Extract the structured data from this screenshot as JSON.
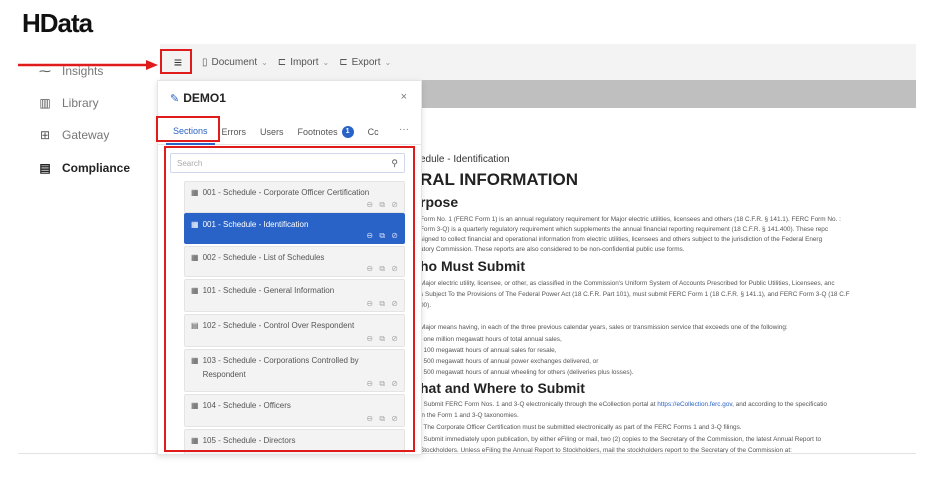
{
  "logo": "HData",
  "nav": [
    {
      "label": "Insights",
      "icon": "insights-icon",
      "glyph": "⁓",
      "active": false
    },
    {
      "label": "Library",
      "icon": "library-icon",
      "glyph": "▥",
      "active": false
    },
    {
      "label": "Gateway",
      "icon": "gateway-icon",
      "glyph": "⊞",
      "active": false
    },
    {
      "label": "Compliance",
      "icon": "compliance-icon",
      "glyph": "▤",
      "active": true
    }
  ],
  "toolbar": {
    "menu_glyph": "≡",
    "items": [
      {
        "label": "Document",
        "glyph": "▯"
      },
      {
        "label": "Import",
        "glyph": "⊏"
      },
      {
        "label": "Export",
        "glyph": "⊏"
      }
    ],
    "caret": "⌄"
  },
  "panel": {
    "title": "DEMO1",
    "close": "×",
    "tabs": [
      {
        "label": "Sections",
        "active": true
      },
      {
        "label": "Errors",
        "active": false
      },
      {
        "label": "Users",
        "active": false
      },
      {
        "label": "Footnotes",
        "active": false,
        "badge": "1"
      },
      {
        "label": "Cc",
        "active": false
      }
    ],
    "more": "···",
    "search_placeholder": "Search",
    "sections": [
      {
        "label": "001 - Schedule - Corporate Officer Certification",
        "glyph": "▦",
        "selected": false
      },
      {
        "label": "001 - Schedule - Identification",
        "glyph": "▦",
        "selected": true
      },
      {
        "label": "002 - Schedule - List of Schedules",
        "glyph": "▦",
        "selected": false
      },
      {
        "label": "101 - Schedule - General Information",
        "glyph": "▦",
        "selected": false
      },
      {
        "label": "102 - Schedule - Control Over Respondent",
        "glyph": "▤",
        "selected": false
      },
      {
        "label": "103 - Schedule - Corporations Controlled by Respondent",
        "glyph": "▦",
        "selected": false
      },
      {
        "label": "104 - Schedule - Officers",
        "glyph": "▦",
        "selected": false
      },
      {
        "label": "105 - Schedule - Directors",
        "glyph": "▦",
        "selected": false
      }
    ],
    "actions": "⊖ ⧉ ⊘"
  },
  "document": {
    "schedule_title": "edule - Identification",
    "heading": "RAL INFORMATION",
    "purpose_heading": "rpose",
    "purpose_lines": [
      "Form No. 1 (FERC Form 1) is an annual regulatory requirement for Major electric utilities, licensees and others (18 C.F.R. § 141.1). FERC Form No. :",
      "Form 3-Q) is a quarterly regulatory requirement which supplements the annual financial reporting requirement (18 C.F.R. § 141.400). These repc",
      "signed to collect financial and operational information from electric utilities, licensees and others subject to the jurisdiction of the Federal Energ",
      "atory Commission. These reports are also considered to be non-confidential public use forms."
    ],
    "who_heading": "ho Must Submit",
    "who_lines": [
      "Major electric utility, licensee, or other, as classified in the Commission's Uniform System of Accounts Prescribed for Public Utilities, Licensees, anc",
      "s Subject To the Provisions of The Federal Power Act (18 C.F.R. Part 101), must submit FERC Form 1 (18 C.F.R. § 141.1), and FERC Form 3-Q (18 C.F",
      "00).",
      "",
      "Major means having, in each of the three previous calendar years, sales or transmission service that exceeds one of the following:",
      ". one million megawatt hours of total annual sales,",
      ". 100 megawatt hours of annual sales for resale,",
      ". 500 megawatt hours of annual power exchanges delivered, or",
      ". 500 megawatt hours of annual wheeling for others (deliveries plus losses)."
    ],
    "what_heading": "hat and Where to Submit",
    "what_line1_pre": ". Submit FERC Form Nos. 1 and 3-Q electronically through the eCollection portal at ",
    "what_link": "https://eCollection.ferc.gov",
    "what_line1_post": ", and according to the specificatio",
    "what_lines": [
      "in the Form 1 and 3-Q taxonomies.",
      ". The Corporate Officer Certification must be submitted electronically as part of the FERC Forms 1 and 3-Q filings.",
      ". Submit immediately upon publication, by either eFiling or mail, two (2) copies to the Secretary of the Commission, the latest Annual Report to",
      "Stockholders. Unless eFiling the Annual Report to Stockholders, mail the stockholders report to the Secretary of the Commission at:"
    ]
  },
  "colors": {
    "accent": "#2a63c7",
    "annotation": "#e01b1b",
    "toolbar_bg": "#f3f3f3",
    "band": "#bfbfbf"
  }
}
